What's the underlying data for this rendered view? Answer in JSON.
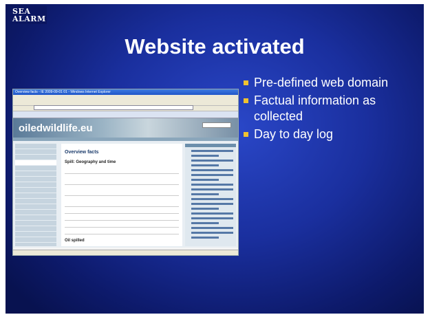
{
  "logo": {
    "line1": "SEA",
    "line2": "ALARM"
  },
  "title": "Website activated",
  "screenshot": {
    "window_title": "Overview facts - IE 2009-09-01 01 - Windows Internet Explorer",
    "site_name": "oiledwildlife.eu",
    "page_heading": "Overview facts",
    "section_heading": "Spill: Geography and time",
    "section2_heading": "Oil spilled"
  },
  "bullets": [
    "Pre-defined web domain",
    "Factual information as collected",
    "Day to day log"
  ],
  "colors": {
    "accent_bullet": "#f0c230",
    "background": "#1a2f9e"
  }
}
